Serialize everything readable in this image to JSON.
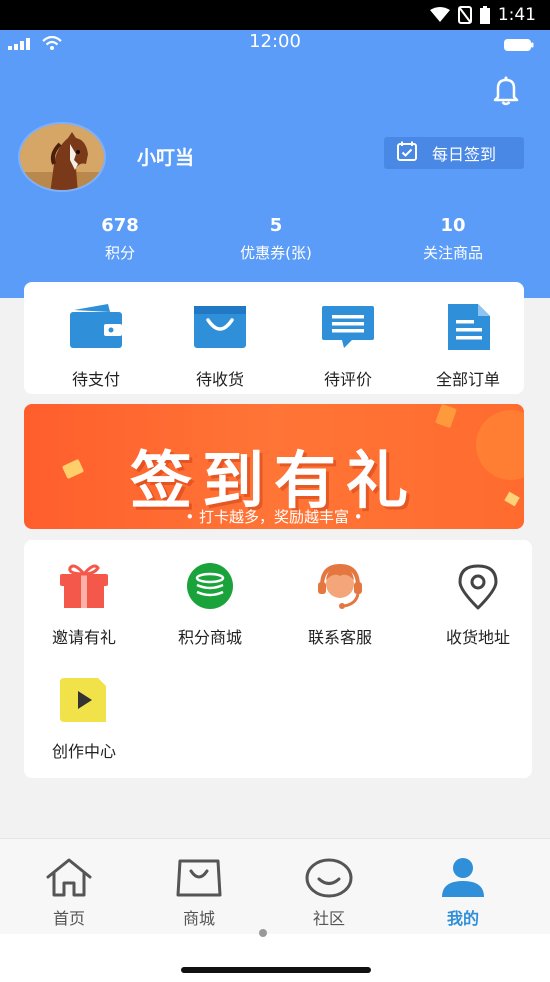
{
  "system_bar": {
    "time": "1:41"
  },
  "status_bar": {
    "time": "12:00"
  },
  "profile": {
    "username": "小叮当",
    "signin_label": "每日签到"
  },
  "stats": [
    {
      "value": "678",
      "label": "积分"
    },
    {
      "value": "5",
      "label": "优惠券(张)"
    },
    {
      "value": "10",
      "label": "关注商品"
    }
  ],
  "orders": [
    {
      "label": "待支付",
      "icon": "wallet-icon"
    },
    {
      "label": "待收货",
      "icon": "bag-icon"
    },
    {
      "label": "待评价",
      "icon": "chat-icon"
    },
    {
      "label": "全部订单",
      "icon": "document-icon"
    }
  ],
  "banner": {
    "title": "签到有礼",
    "subtitle": "• 打卡越多，奖励越丰富 •"
  },
  "services": [
    {
      "label": "邀请有礼",
      "icon": "gift-icon"
    },
    {
      "label": "积分商城",
      "icon": "coins-icon"
    },
    {
      "label": "联系客服",
      "icon": "headset-icon"
    },
    {
      "label": "收货地址",
      "icon": "location-icon"
    },
    {
      "label": "创作中心",
      "icon": "video-icon"
    }
  ],
  "tabs": [
    {
      "label": "首页",
      "icon": "home-icon",
      "active": false
    },
    {
      "label": "商城",
      "icon": "shop-bag-icon",
      "active": false
    },
    {
      "label": "社区",
      "icon": "smile-icon",
      "active": false
    },
    {
      "label": "我的",
      "icon": "user-icon",
      "active": true
    }
  ],
  "colors": {
    "header_bg": "#5a9cf8",
    "order_icon_blue": "#2f8fd8",
    "banner_orange": "#ff6a30",
    "active_tab": "#2f8fd8"
  }
}
